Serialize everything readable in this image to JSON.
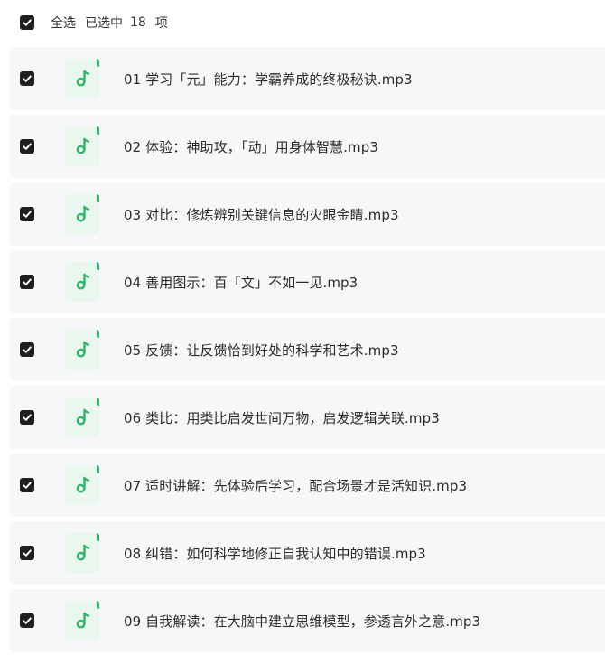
{
  "header": {
    "select_all_label": "全选",
    "selected_prefix": "已选中",
    "selected_count": "18",
    "selected_suffix": "项"
  },
  "colors": {
    "checkbox": "#1f1f1f",
    "icon_bg": "#eaf7ef",
    "icon_accent": "#2fb56a",
    "row_bg": "#f6f7f9"
  },
  "icon": "music-note-icon",
  "files": [
    {
      "name": "01 学习「元」能力：学霸养成的终极秘诀.mp3",
      "checked": true
    },
    {
      "name": "02 体验：神助攻，「动」用身体智慧.mp3",
      "checked": true
    },
    {
      "name": "03 对比：修炼辨别关键信息的火眼金睛.mp3",
      "checked": true
    },
    {
      "name": "04 善用图示：百「文」不如一见.mp3",
      "checked": true
    },
    {
      "name": "05 反馈：让反馈恰到好处的科学和艺术.mp3",
      "checked": true
    },
    {
      "name": "06 类比：用类比启发世间万物，启发逻辑关联.mp3",
      "checked": true
    },
    {
      "name": "07 适时讲解：先体验后学习，配合场景才是活知识.mp3",
      "checked": true
    },
    {
      "name": "08 纠错：如何科学地修正自我认知中的错误.mp3",
      "checked": true
    },
    {
      "name": "09 自我解读：在大脑中建立思维模型，参透言外之意.mp3",
      "checked": true
    }
  ]
}
